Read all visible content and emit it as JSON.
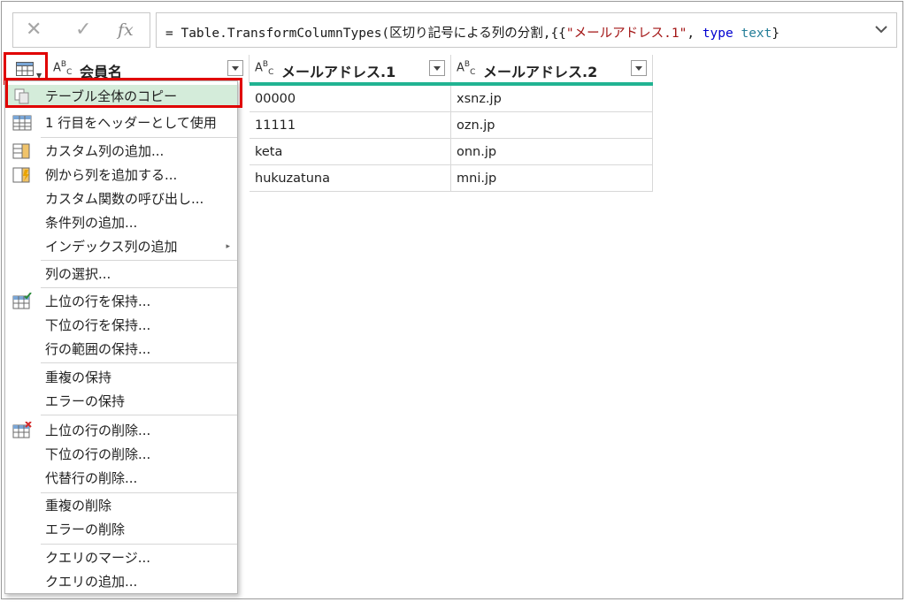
{
  "formula_bar": {
    "cancel_icon": "cancel-icon",
    "commit_icon": "check-icon",
    "fx_label": "fx",
    "formula_prefix": "= Table.TransformColumnTypes(区切り記号による列の分割,{{",
    "formula_string": "\"メールアドレス.1\"",
    "formula_sep": ", ",
    "formula_kw": "type",
    "formula_space": " ",
    "formula_type": "text",
    "formula_suffix": "}"
  },
  "table": {
    "columns": [
      {
        "type": "ABC",
        "name": "会員名"
      },
      {
        "type": "ABC",
        "name": "メールアドレス.1"
      },
      {
        "type": "ABC",
        "name": "メールアドレス.2"
      }
    ],
    "rows": [
      [
        "",
        "00000",
        "xsnz.jp"
      ],
      [
        "",
        "11111",
        "ozn.jp"
      ],
      [
        "",
        "keta",
        "onn.jp"
      ],
      [
        "",
        "hukuzatuna",
        "mni.jp"
      ]
    ],
    "accent_color": "#21b392"
  },
  "menu": {
    "items": [
      {
        "label": "テーブル全体のコピー",
        "icon": "copy-icon",
        "highlighted": true
      },
      {
        "label": "1 行目をヘッダーとして使用",
        "icon": "table-header-icon"
      },
      {
        "label": "カスタム列の追加...",
        "icon": "custom-column-icon"
      },
      {
        "label": "例から列を追加する...",
        "icon": "column-from-examples-icon"
      },
      {
        "label": "カスタム関数の呼び出し..."
      },
      {
        "label": "条件列の追加..."
      },
      {
        "label": "インデックス列の追加",
        "submenu": "▸"
      },
      {
        "label": "列の選択..."
      },
      {
        "label": "上位の行を保持...",
        "icon": "keep-rows-icon"
      },
      {
        "label": "下位の行を保持..."
      },
      {
        "label": "行の範囲の保持..."
      },
      {
        "label": "重複の保持"
      },
      {
        "label": "エラーの保持"
      },
      {
        "label": "上位の行の削除...",
        "icon": "remove-rows-icon"
      },
      {
        "label": "下位の行の削除..."
      },
      {
        "label": "代替行の削除..."
      },
      {
        "label": "重複の削除"
      },
      {
        "label": "エラーの削除"
      },
      {
        "label": "クエリのマージ..."
      },
      {
        "label": "クエリの追加..."
      }
    ]
  },
  "highlight_color": "#e00000"
}
